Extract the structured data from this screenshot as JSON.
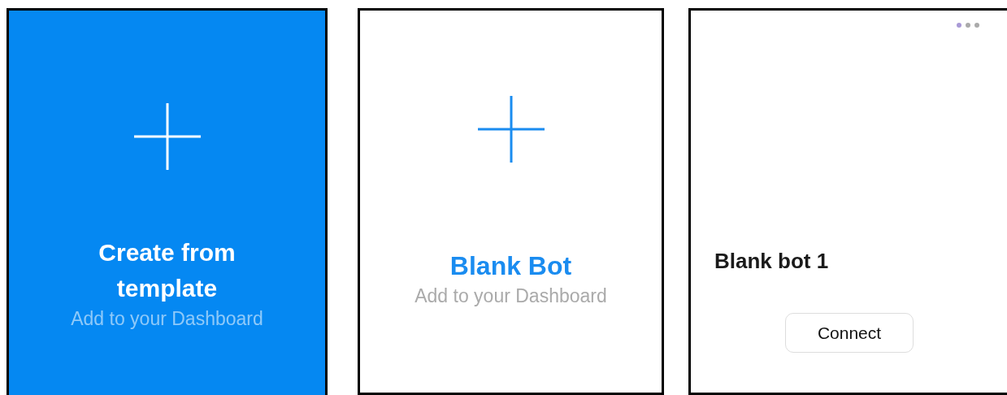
{
  "cards": [
    {
      "kind": "template",
      "title": "Create from template",
      "subtitle": "Add to your Dashboard"
    },
    {
      "kind": "blank",
      "title": "Blank Bot",
      "subtitle": "Add to your Dashboard"
    },
    {
      "kind": "bot",
      "title": "Blank bot 1",
      "button": "Connect"
    }
  ]
}
